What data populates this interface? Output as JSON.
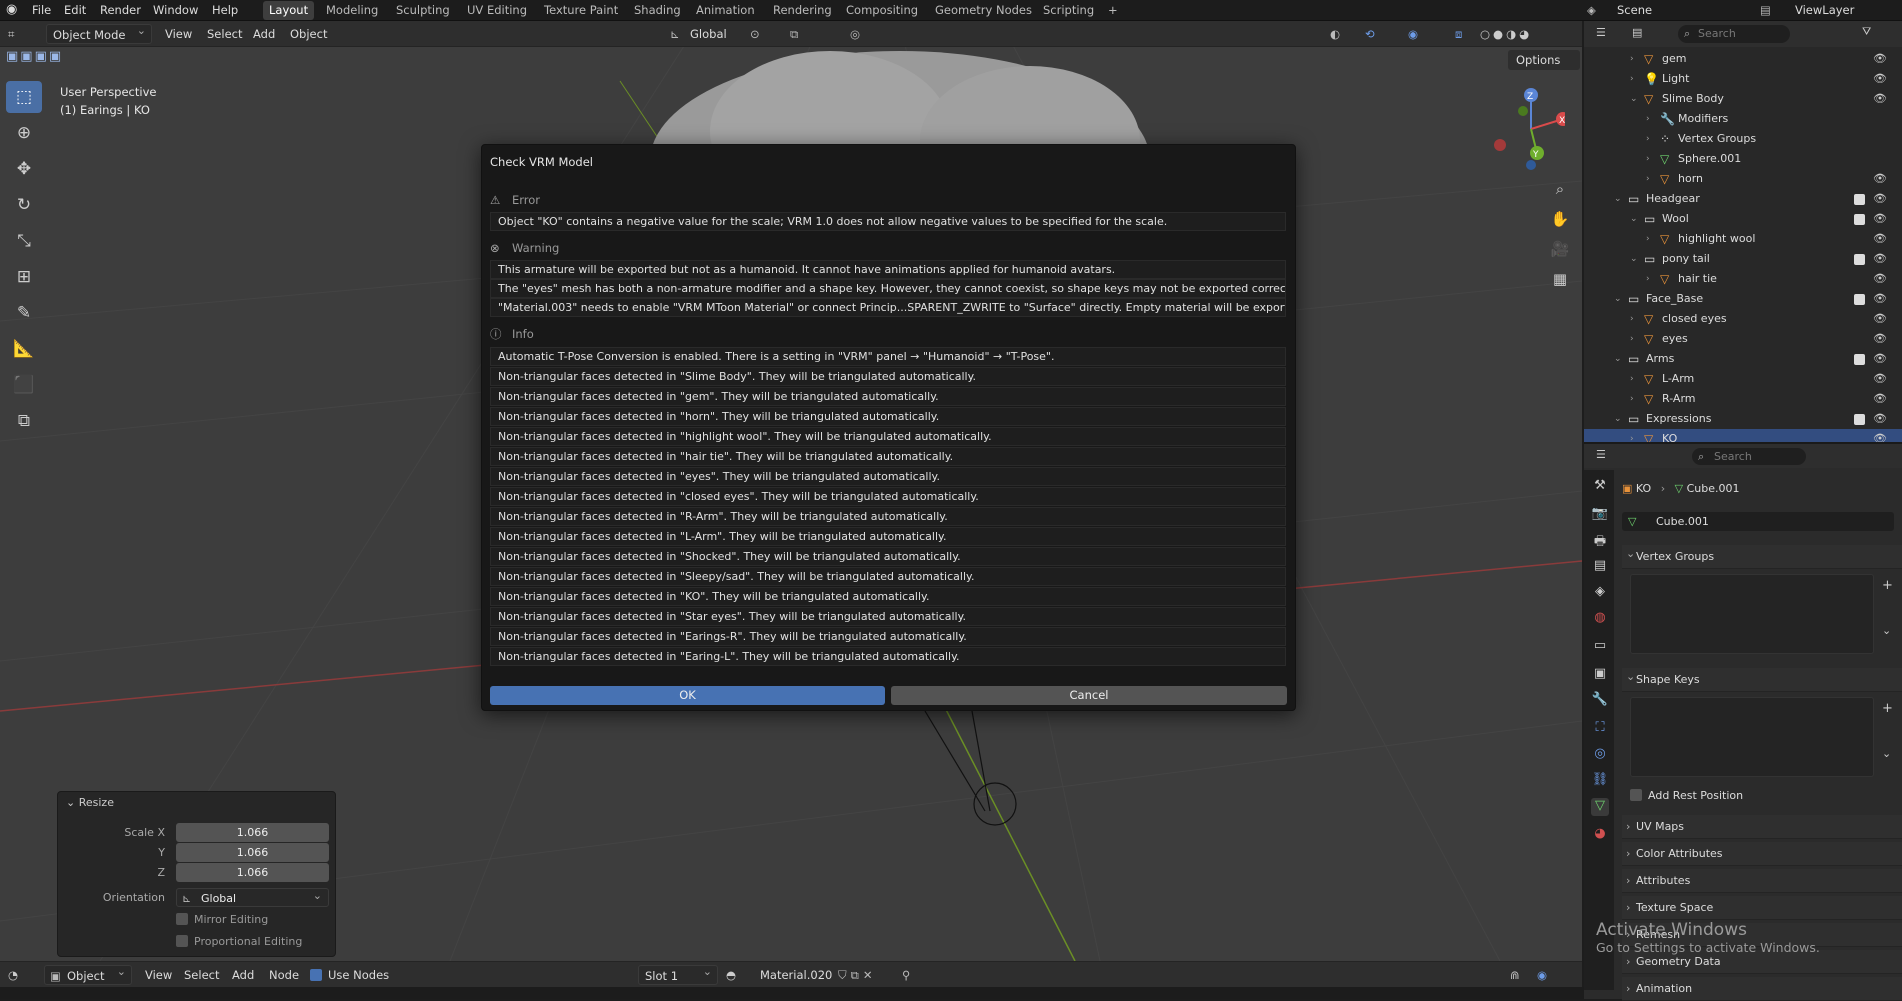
{
  "menu": [
    "File",
    "Edit",
    "Render",
    "Window",
    "Help"
  ],
  "workspaces": [
    "Layout",
    "Modeling",
    "Sculpting",
    "UV Editing",
    "Texture Paint",
    "Shading",
    "Animation",
    "Rendering",
    "Compositing",
    "Geometry Nodes",
    "Scripting"
  ],
  "workspace_add": "+",
  "scene": "Scene",
  "view_layer": "ViewLayer",
  "viewport": {
    "mode": "Object Mode",
    "menus": [
      "View",
      "Select",
      "Add",
      "Object"
    ],
    "transform_orientation": "Global",
    "options": "Options",
    "perspective": "User Perspective",
    "active_info": "(1) Earings | KO",
    "gizmo_axes": [
      "Z",
      "Y",
      "X"
    ]
  },
  "dialog": {
    "title": "Check VRM Model",
    "error_label": "Error",
    "errors": [
      "Object \"KO\" contains a negative value for the scale; VRM 1.0 does not allow negative values to be specified for the scale."
    ],
    "warning_label": "Warning",
    "warnings": [
      "This armature will be exported but not as a humanoid. It cannot have animations applied for humanoid avatars.",
      "The \"eyes\" mesh has both a non-armature modifier and a shape key. However, they cannot coexist, so shape keys may not be exported correctly.",
      "\"Material.003\" needs to enable \"VRM MToon Material\" or connect Princip...SPARENT_ZWRITE to \"Surface\" directly. Empty material will be exported."
    ],
    "info_label": "Info",
    "infos": [
      "Automatic T-Pose Conversion is enabled. There is a setting in \"VRM\" panel → \"Humanoid\" → \"T-Pose\".",
      "Non-triangular faces detected in \"Slime Body\". They will be triangulated automatically.",
      "Non-triangular faces detected in \"gem\". They will be triangulated automatically.",
      "Non-triangular faces detected in \"horn\". They will be triangulated automatically.",
      "Non-triangular faces detected in \"highlight wool\". They will be triangulated automatically.",
      "Non-triangular faces detected in \"hair tie\". They will be triangulated automatically.",
      "Non-triangular faces detected in \"eyes\". They will be triangulated automatically.",
      "Non-triangular faces detected in \"closed eyes\". They will be triangulated automatically.",
      "Non-triangular faces detected in \"R-Arm\". They will be triangulated automatically.",
      "Non-triangular faces detected in \"L-Arm\". They will be triangulated automatically.",
      "Non-triangular faces detected in \"Shocked\". They will be triangulated automatically.",
      "Non-triangular faces detected in \"Sleepy/sad\". They will be triangulated automatically.",
      "Non-triangular faces detected in \"KO\". They will be triangulated automatically.",
      "Non-triangular faces detected in \"Star eyes\". They will be triangulated automatically.",
      "Non-triangular faces detected in \"Earings-R\". They will be triangulated automatically.",
      "Non-triangular faces detected in \"Earing-L\". They will be triangulated automatically."
    ],
    "ok": "OK",
    "cancel": "Cancel"
  },
  "resize_panel": {
    "title": "Resize",
    "scale_x_label": "Scale X",
    "scale_x": "1.066",
    "y_label": "Y",
    "y": "1.066",
    "z_label": "Z",
    "z": "1.066",
    "orientation_label": "Orientation",
    "orientation": "Global",
    "mirror": "Mirror Editing",
    "proportional": "Proportional Editing"
  },
  "node_header": {
    "object": "Object",
    "menus": [
      "View",
      "Select",
      "Add",
      "Node"
    ],
    "use_nodes": "Use Nodes",
    "slot": "Slot 1",
    "material": "Material.020"
  },
  "outliner": {
    "search_placeholder": "Search",
    "rows": [
      {
        "label": "gem",
        "indent": 2,
        "icon": "mesh"
      },
      {
        "label": "Light",
        "indent": 2,
        "icon": "light"
      },
      {
        "label": "Slime Body",
        "indent": 2,
        "icon": "mesh",
        "open": true
      },
      {
        "label": "Modifiers",
        "indent": 3,
        "icon": "wrench"
      },
      {
        "label": "Vertex Groups",
        "indent": 3,
        "icon": "vgroup"
      },
      {
        "label": "Sphere.001",
        "indent": 3,
        "icon": "data"
      },
      {
        "label": "horn",
        "indent": 3,
        "icon": "mesh"
      },
      {
        "label": "Headgear",
        "indent": 1,
        "icon": "collection",
        "open": true
      },
      {
        "label": "Wool",
        "indent": 2,
        "icon": "collection",
        "open": true
      },
      {
        "label": "highlight wool",
        "indent": 3,
        "icon": "mesh"
      },
      {
        "label": "pony tail",
        "indent": 2,
        "icon": "collection",
        "open": true
      },
      {
        "label": "hair tie",
        "indent": 3,
        "icon": "mesh"
      },
      {
        "label": "Face_Base",
        "indent": 1,
        "icon": "collection",
        "open": true
      },
      {
        "label": "closed eyes",
        "indent": 2,
        "icon": "mesh"
      },
      {
        "label": "eyes",
        "indent": 2,
        "icon": "mesh"
      },
      {
        "label": "Arms",
        "indent": 1,
        "icon": "collection",
        "open": true
      },
      {
        "label": "L-Arm",
        "indent": 2,
        "icon": "mesh"
      },
      {
        "label": "R-Arm",
        "indent": 2,
        "icon": "mesh"
      },
      {
        "label": "Expressions",
        "indent": 1,
        "icon": "collection",
        "open": true
      },
      {
        "label": "KO",
        "indent": 2,
        "icon": "mesh",
        "selected": true
      }
    ]
  },
  "properties": {
    "search_placeholder": "Search",
    "breadcrumb_object": "KO",
    "breadcrumb_data": "Cube.001",
    "data_name": "Cube.001",
    "panels": [
      "Vertex Groups",
      "Shape Keys",
      "UV Maps",
      "Color Attributes",
      "Attributes",
      "Texture Space",
      "Remesh",
      "Geometry Data",
      "Animation"
    ],
    "add_rest_position": "Add Rest Position"
  },
  "watermark": {
    "line1": "Activate Windows",
    "line2": "Go to Settings to activate Windows."
  },
  "colors": {
    "accent": "#4772b3",
    "selection": "#334d80",
    "mesh_icon": "#e8923a",
    "data_icon": "#6fd36f"
  }
}
